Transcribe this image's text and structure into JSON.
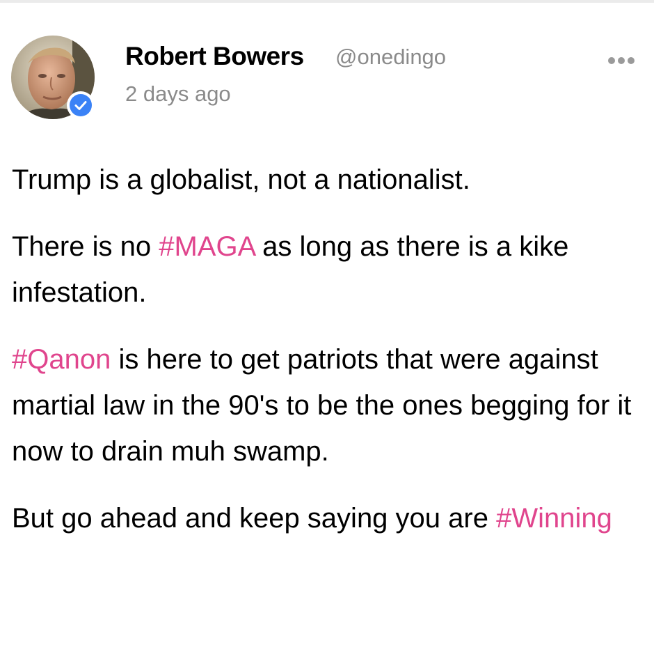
{
  "post": {
    "author": {
      "name": "Robert Bowers",
      "handle": "@onedingo",
      "verified": true,
      "avatar_icon": "profile-photo"
    },
    "timestamp": "2 days ago",
    "more_icon": "ellipsis-icon",
    "paragraphs": [
      [
        {
          "text": "Trump is a globalist, not a nationalist."
        }
      ],
      [
        {
          "text": "There is no "
        },
        {
          "text": "#MAGA",
          "hashtag": true
        },
        {
          "text": " as long as there is a kike infestation."
        }
      ],
      [
        {
          "text": "#Qanon",
          "hashtag": true
        },
        {
          "text": " is here to get patriots that were against martial law in the 90's to be the ones begging for it now to drain muh swamp."
        }
      ],
      [
        {
          "text": "But go ahead and keep saying you are "
        },
        {
          "text": "#Winning",
          "hashtag": true
        }
      ]
    ]
  },
  "colors": {
    "hashtag": "#e0458d",
    "muted_text": "#8a8a8a",
    "verified_badge": "#3b82f6",
    "background": "#ffffff"
  }
}
